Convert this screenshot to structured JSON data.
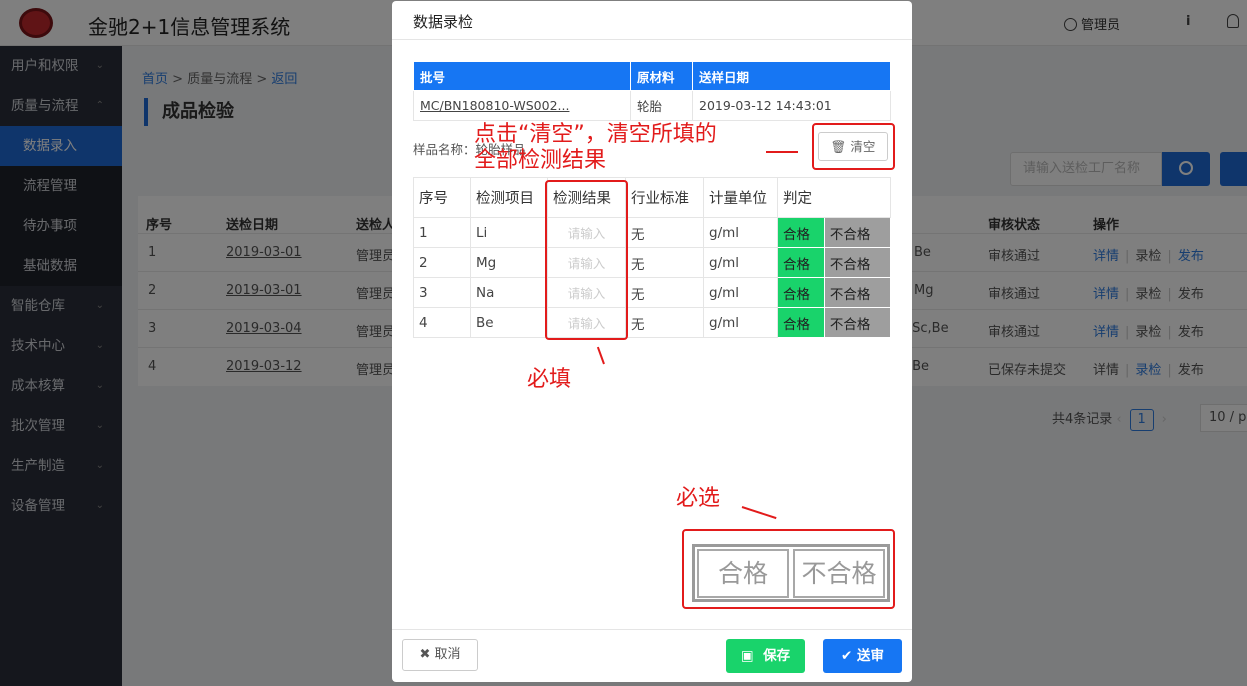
{
  "app": {
    "title": "金驰2+1信息管理系统",
    "user": "管理员"
  },
  "sidebar": {
    "items": [
      {
        "label": "用户和权限",
        "chevron": "down"
      },
      {
        "label": "质量与流程",
        "chevron": "up"
      },
      {
        "label": "数据录入",
        "sub": true,
        "active": true
      },
      {
        "label": "流程管理",
        "sub": true
      },
      {
        "label": "待办事项",
        "sub": true
      },
      {
        "label": "基础数据",
        "sub": true
      },
      {
        "label": "智能仓库",
        "chevron": "down"
      },
      {
        "label": "技术中心",
        "chevron": "down"
      },
      {
        "label": "成本核算",
        "chevron": "down"
      },
      {
        "label": "批次管理",
        "chevron": "down"
      },
      {
        "label": "生产制造",
        "chevron": "down"
      },
      {
        "label": "设备管理",
        "chevron": "down"
      }
    ]
  },
  "breadcrumb": {
    "home": "首页",
    "section": "质量与流程",
    "back": "返回"
  },
  "page": {
    "title": "成品检验",
    "search_placeholder": "请输入送检工厂名称",
    "columns": {
      "no": "序号",
      "date": "送检日期",
      "person": "送检人",
      "status": "审核状态",
      "ops": "操作"
    },
    "rows": [
      {
        "no": "1",
        "date": "2019-03-01",
        "person": "管理员",
        "items": "Be",
        "status": "审核通过",
        "ops": [
          "详情",
          "录检",
          "发布"
        ]
      },
      {
        "no": "2",
        "date": "2019-03-01",
        "person": "管理员",
        "items": "Mg",
        "status": "审核通过",
        "ops": [
          "详情",
          "录检",
          "发布"
        ]
      },
      {
        "no": "3",
        "date": "2019-03-04",
        "person": "管理员",
        "items": ",Sc,Be",
        "status": "审核通过",
        "ops": [
          "详情",
          "录检",
          "发布"
        ]
      },
      {
        "no": "4",
        "date": "2019-03-12",
        "person": "管理员",
        "items": ",Be",
        "status": "已保存未提交",
        "ops": [
          "详情",
          "录检",
          "发布"
        ]
      }
    ],
    "pager": {
      "total": "共4条记录",
      "current": "1",
      "page_size": "10 / p"
    }
  },
  "modal": {
    "title": "数据录检",
    "info_headers": [
      "批号",
      "原材料",
      "送样日期"
    ],
    "info_row": {
      "batch": "MC/BN180810-WS002...",
      "material": "轮胎",
      "date": "2019-03-12 14:43:01"
    },
    "sample_label": "样品名称：轮胎样品",
    "clear_label": "清空",
    "test_headers": [
      "序号",
      "检测项目",
      "检测结果",
      "行业标准",
      "计量单位",
      "判定"
    ],
    "tests": [
      {
        "no": "1",
        "item": "Li",
        "placeholder": "请输入",
        "standard": "无",
        "unit": "g/ml",
        "pass": "合格",
        "fail": "不合格"
      },
      {
        "no": "2",
        "item": "Mg",
        "placeholder": "请输入",
        "standard": "无",
        "unit": "g/ml",
        "pass": "合格",
        "fail": "不合格"
      },
      {
        "no": "3",
        "item": "Na",
        "placeholder": "请输入",
        "standard": "无",
        "unit": "g/ml",
        "pass": "合格",
        "fail": "不合格"
      },
      {
        "no": "4",
        "item": "Be",
        "placeholder": "请输入",
        "standard": "无",
        "unit": "g/ml",
        "pass": "合格",
        "fail": "不合格"
      }
    ],
    "judge_pass": "合格",
    "judge_fail": "不合格",
    "cancel": "取消",
    "save": "保存",
    "submit": "送审"
  },
  "annotations": {
    "clear_note_line1": "点击“清空”，清空所填的",
    "clear_note_line2": "全部检测结果",
    "required": "必填",
    "must_select": "必选"
  },
  "colors": {
    "primary": "#1676f3",
    "pass": "#19d36b",
    "fail": "#9e9e9e",
    "annotation": "#e21b1b",
    "sidebar": "#2b2f3a"
  }
}
